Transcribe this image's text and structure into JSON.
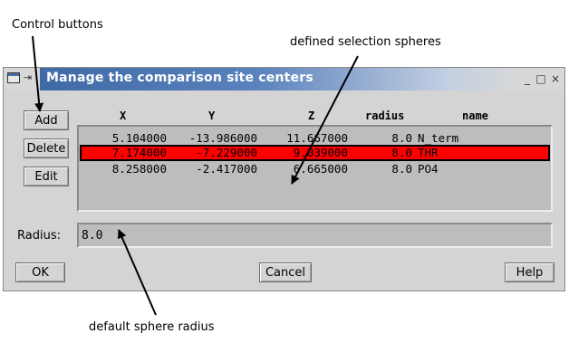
{
  "annotations": {
    "control_buttons": "Control buttons",
    "defined_spheres": "defined selection spheres",
    "default_radius": "default sphere radius"
  },
  "window": {
    "title": "Manage the comparison site centers",
    "minimize": "_",
    "maximize": "□",
    "close": "×"
  },
  "side_buttons": {
    "add": "Add",
    "delete": "Delete",
    "edit": "Edit"
  },
  "table": {
    "columns": [
      "X",
      "Y",
      "Z",
      "radius",
      "name"
    ],
    "rows": [
      {
        "x": "5.104000",
        "y": "-13.986000",
        "z": "11.667000",
        "radius": "8.0",
        "name": "N_term",
        "selected": false
      },
      {
        "x": "7.174000",
        "y": "-7.229000",
        "z": "9.039000",
        "radius": "8.0",
        "name": "THR",
        "selected": true
      },
      {
        "x": "8.258000",
        "y": "-2.417000",
        "z": "6.665000",
        "radius": "8.0",
        "name": "PO4",
        "selected": false
      }
    ]
  },
  "radius": {
    "label": "Radius:",
    "value": "8.0"
  },
  "bottom_buttons": {
    "ok": "OK",
    "cancel": "Cancel",
    "help": "Help"
  },
  "colors": {
    "selected_row": "#ff0000",
    "title_bar": "#3f6aa6",
    "window_bg": "#d4d4d4"
  }
}
